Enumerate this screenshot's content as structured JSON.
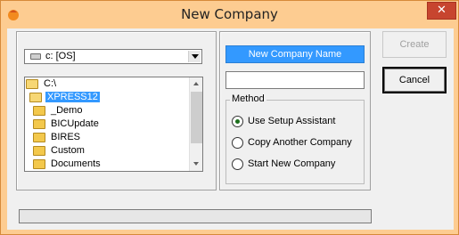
{
  "window": {
    "title": "New Company",
    "close_glyph": "✕",
    "colors": {
      "titlebar": "#fdcc91",
      "close": "#c7452f",
      "selection": "#3399ff"
    }
  },
  "drive": {
    "value": "c: [OS]",
    "icon": "drive-icon"
  },
  "directories": [
    {
      "label": "C:\\",
      "icon": "open-folder-icon",
      "level": 0,
      "selected": false
    },
    {
      "label": "XPRESS12",
      "icon": "open-folder-icon",
      "level": 1,
      "selected": true
    },
    {
      "label": "_Demo",
      "icon": "folder-icon",
      "level": 2,
      "selected": false
    },
    {
      "label": "BICUpdate",
      "icon": "folder-icon",
      "level": 2,
      "selected": false
    },
    {
      "label": "BIRES",
      "icon": "folder-icon",
      "level": 2,
      "selected": false
    },
    {
      "label": "Custom",
      "icon": "folder-icon",
      "level": 2,
      "selected": false
    },
    {
      "label": "Documents",
      "icon": "folder-icon",
      "level": 2,
      "selected": false
    }
  ],
  "company": {
    "name_label": "New Company Name",
    "name_value": ""
  },
  "method": {
    "legend": "Method",
    "options": [
      {
        "label": "Use Setup Assistant",
        "checked": true
      },
      {
        "label": "Copy Another Company",
        "checked": false
      },
      {
        "label": "Start New Company",
        "checked": false
      }
    ]
  },
  "buttons": {
    "create": "Create",
    "cancel": "Cancel"
  },
  "progress": {
    "value": 0
  }
}
